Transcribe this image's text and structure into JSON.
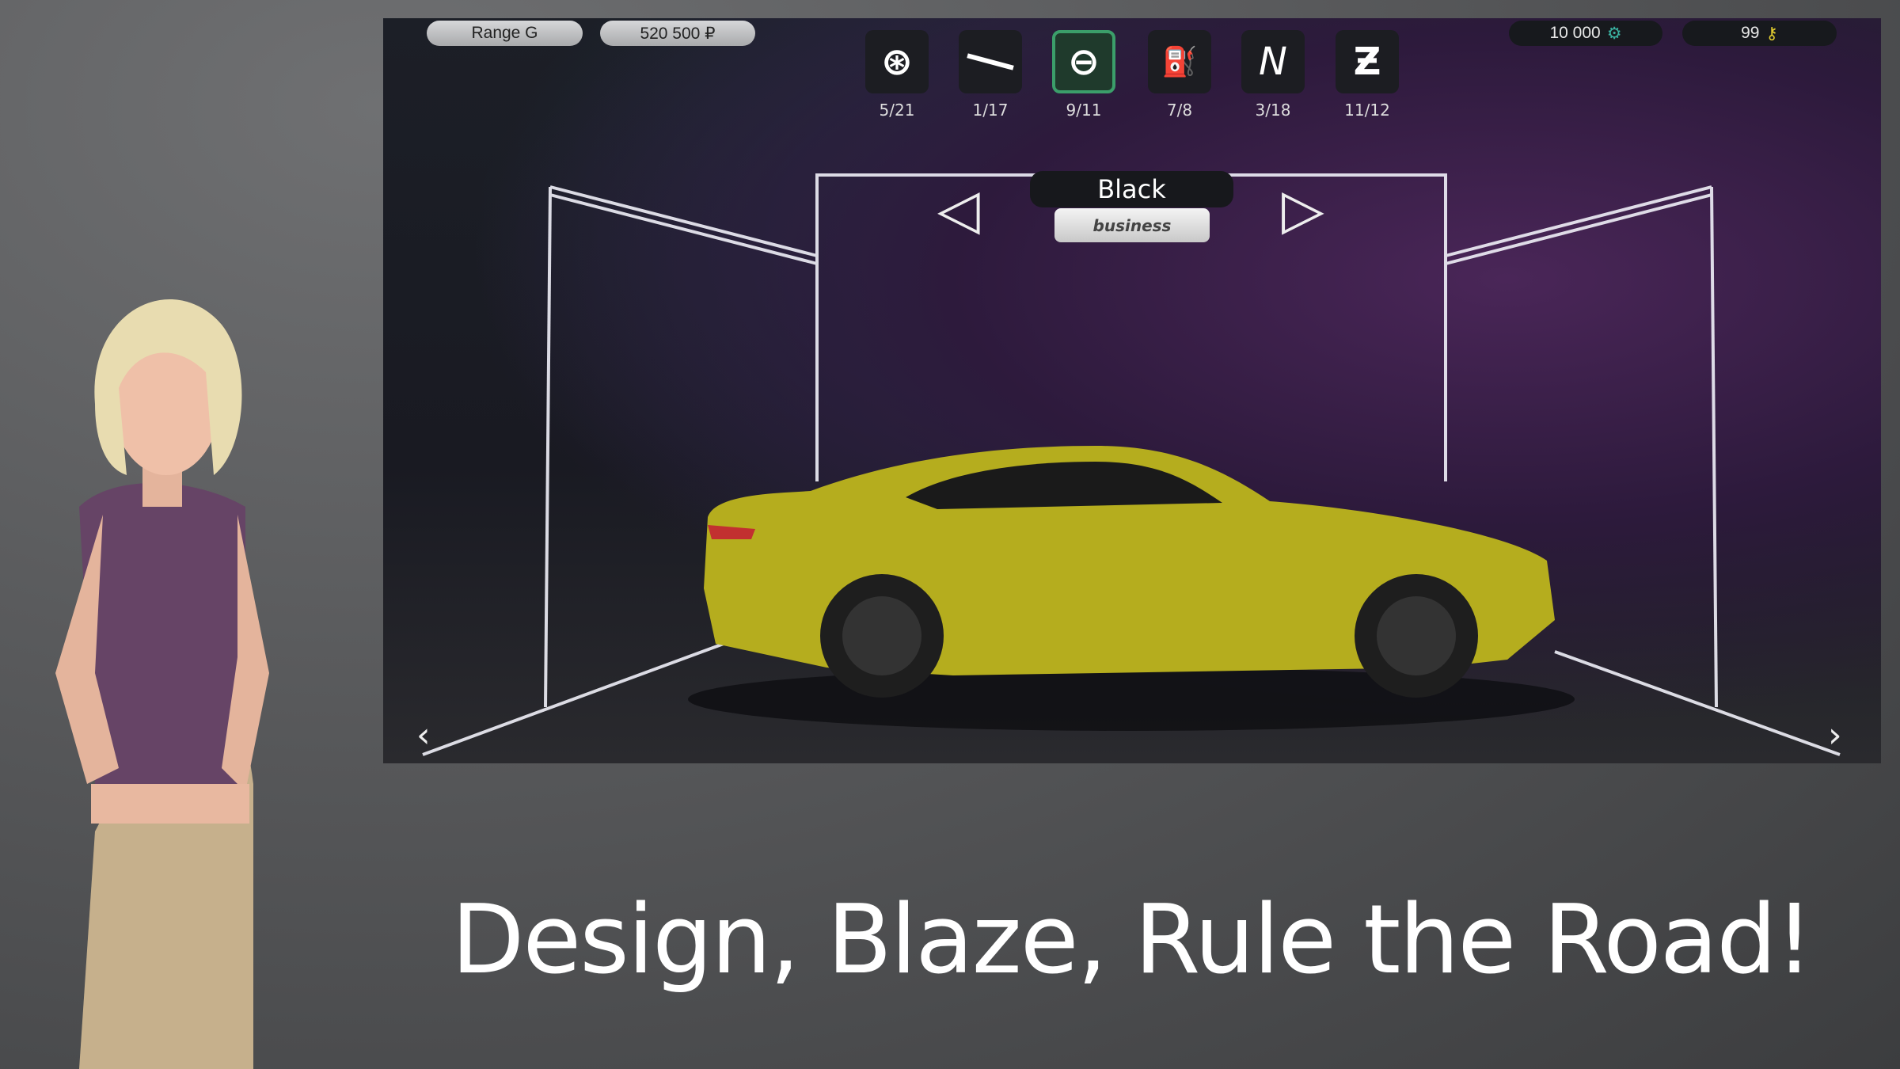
{
  "top_bar": {
    "car_name": "Range G",
    "price": "520 500 ₽",
    "coins": "10 000",
    "coins_icon": "gear-coin-icon",
    "keys": "99",
    "keys_icon": "key-icon"
  },
  "tools": [
    {
      "icon": "wheel-icon",
      "progress": "5/21",
      "selected": false
    },
    {
      "icon": "spoiler-icon",
      "progress": "1/17",
      "selected": false
    },
    {
      "icon": "paint-icon",
      "progress": "9/11",
      "selected": true
    },
    {
      "icon": "fuel-icon",
      "progress": "7/8",
      "selected": false
    },
    {
      "icon": "n-letter-icon",
      "progress": "3/18",
      "selected": false
    },
    {
      "icon": "z-letter-icon",
      "progress": "11/12",
      "selected": false
    }
  ],
  "paint": {
    "name": "Black",
    "category": "business"
  },
  "headline": "Design, Blaze, Rule the Road!",
  "colors": {
    "car": "#b5ad1e",
    "selected_accent": "#3b9e6a"
  }
}
